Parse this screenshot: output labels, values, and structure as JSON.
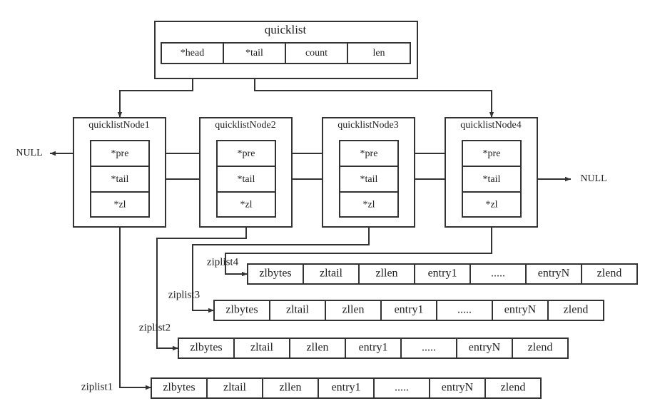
{
  "quicklist": {
    "title": "quicklist",
    "fields": [
      "*head",
      "*tail",
      "count",
      "len"
    ]
  },
  "nodes": [
    {
      "title": "quicklistNode1",
      "fields": [
        "*pre",
        "*tail",
        "*zl"
      ]
    },
    {
      "title": "quicklistNode2",
      "fields": [
        "*pre",
        "*tail",
        "*zl"
      ]
    },
    {
      "title": "quicklistNode3",
      "fields": [
        "*pre",
        "*tail",
        "*zl"
      ]
    },
    {
      "title": "quicklistNode4",
      "fields": [
        "*pre",
        "*tail",
        "*zl"
      ]
    }
  ],
  "null_left": "NULL",
  "null_right": "NULL",
  "ziplists": [
    {
      "label": "ziplist1",
      "fields": [
        "zlbytes",
        "zltail",
        "zllen",
        "entry1",
        ".....",
        "entryN",
        "zlend"
      ]
    },
    {
      "label": "ziplist2",
      "fields": [
        "zlbytes",
        "zltail",
        "zllen",
        "entry1",
        ".....",
        "entryN",
        "zlend"
      ]
    },
    {
      "label": "ziplist3",
      "fields": [
        "zlbytes",
        "zltail",
        "zllen",
        "entry1",
        ".....",
        "entryN",
        "zlend"
      ]
    },
    {
      "label": "ziplist4",
      "fields": [
        "zlbytes",
        "zltail",
        "zllen",
        "entry1",
        ".....",
        "entryN",
        "zlend"
      ]
    }
  ],
  "colors": {
    "stroke": "#333333",
    "background": "#ffffff"
  }
}
